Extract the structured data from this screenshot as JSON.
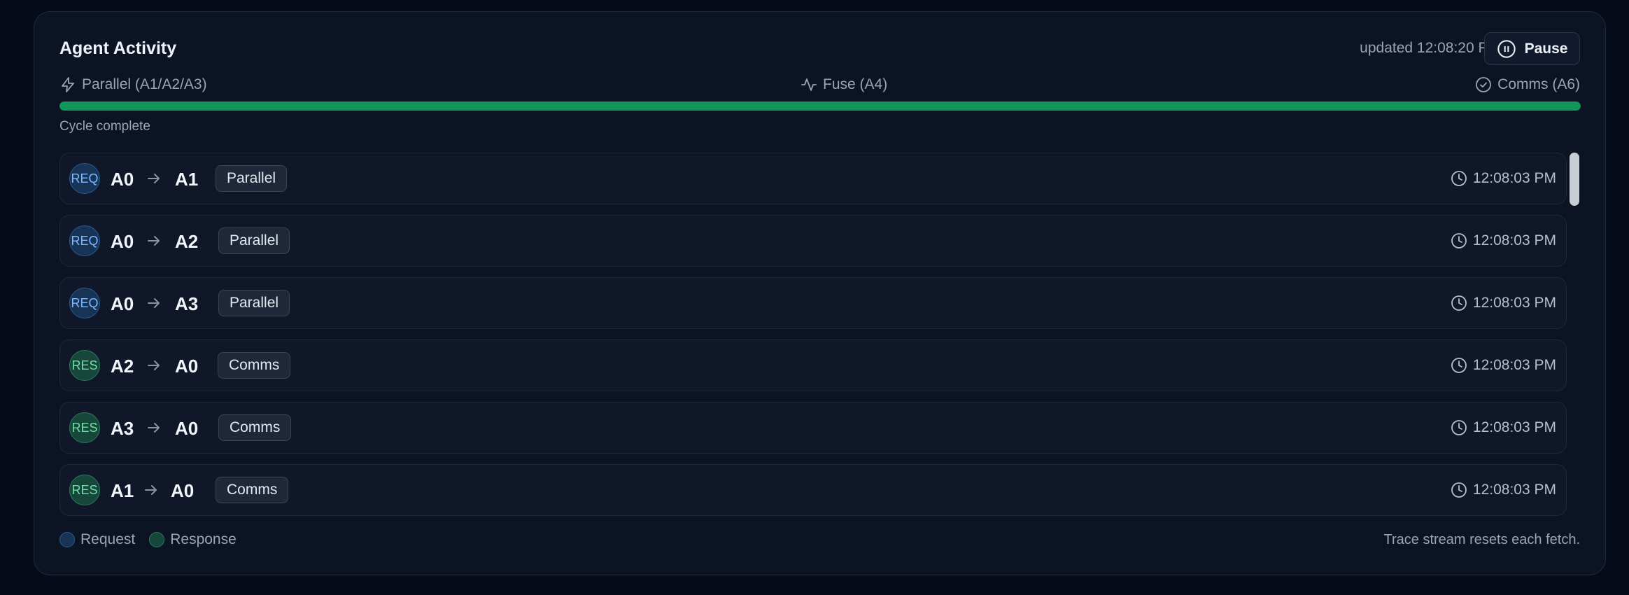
{
  "panel": {
    "title": "Agent Activity",
    "updated": "updated 12:08:20 PM",
    "pause_label": "Pause"
  },
  "phases": {
    "parallel": "Parallel (A1/A2/A3)",
    "fuse": "Fuse (A4)",
    "comms": "Comms (A6)"
  },
  "progress": {
    "percent": 100,
    "color": "#10955a"
  },
  "status": "Cycle complete",
  "rows": [
    {
      "kind": "REQ",
      "from": "A0",
      "to": "A1",
      "tag": "Parallel",
      "time": "12:08:03 PM"
    },
    {
      "kind": "REQ",
      "from": "A0",
      "to": "A2",
      "tag": "Parallel",
      "time": "12:08:03 PM"
    },
    {
      "kind": "REQ",
      "from": "A0",
      "to": "A3",
      "tag": "Parallel",
      "time": "12:08:03 PM"
    },
    {
      "kind": "RES",
      "from": "A2",
      "to": "A0",
      "tag": "Comms",
      "time": "12:08:03 PM"
    },
    {
      "kind": "RES",
      "from": "A3",
      "to": "A0",
      "tag": "Comms",
      "time": "12:08:03 PM"
    },
    {
      "kind": "RES",
      "from": "A1",
      "to": "A0",
      "tag": "Comms",
      "time": "12:08:03 PM"
    }
  ],
  "legend": {
    "request": "Request",
    "response": "Response"
  },
  "footer_note": "Trace stream resets each fetch.",
  "colors": {
    "request": "#2a5a8c",
    "response": "#2a7a5c",
    "accent_progress": "#10955a"
  }
}
